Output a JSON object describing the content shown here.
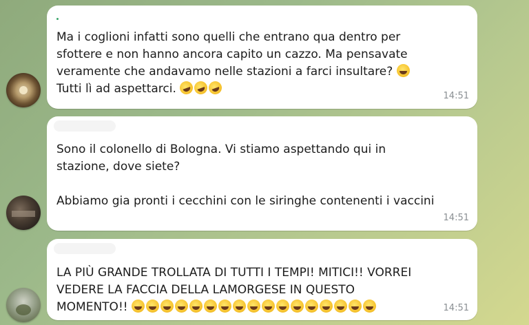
{
  "messages": [
    {
      "lines": [
        "Ma i coglioni infatti sono quelli che entrano qua dentro per",
        "sfottere e non hanno ancora capito un cazzo. Ma pensavate",
        "veramente che andavamo nelle stazioni a farci insultare?",
        "Tutti lì ad aspettarci."
      ],
      "time": "14:51"
    },
    {
      "lines": [
        "Sono il colonello di Bologna. Vi stiamo aspettando qui in",
        "stazione, dove siete?",
        "Abbiamo gia pronti i cecchini con le siringhe contenenti i vaccini"
      ],
      "time": "14:51"
    },
    {
      "lines": [
        "LA PIÙ GRANDE TROLLATA DI TUTTI I TEMPI! MITICI!! VORREI",
        "VEDERE LA FACCIA DELLA LAMORGESE IN QUESTO",
        "MOMENTO!!"
      ],
      "time": "14:51"
    }
  ],
  "icons": {
    "emoji": "laughing-emoji"
  },
  "colors": {
    "bubble": "#ffffff",
    "timestamp": "#8a8f93",
    "wallpaper": "#9cb98a"
  }
}
